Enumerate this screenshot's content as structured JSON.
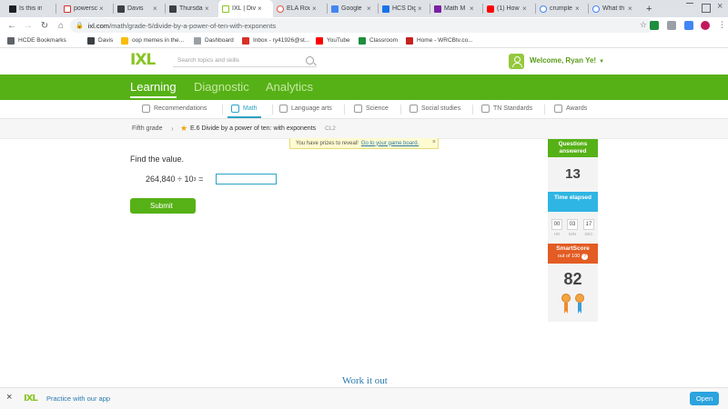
{
  "browser": {
    "tabs": [
      {
        "label": "Is this in",
        "icon": "square-icon",
        "color": "#202124"
      },
      {
        "label": "powersc",
        "icon": "gmail-icon",
        "color": "#d93025"
      },
      {
        "label": "Davis",
        "icon": "square-icon",
        "color": "#3c4043"
      },
      {
        "label": "Thursda",
        "icon": "square-icon",
        "color": "#3c4043"
      },
      {
        "label": "IXL | Div",
        "icon": "ixl-icon",
        "color": "#87c522"
      },
      {
        "label": "ELA Rou",
        "icon": "gear-icon",
        "color": "#e8523e"
      },
      {
        "label": "Google",
        "icon": "docs-icon",
        "color": "#4285f4"
      },
      {
        "label": "HCS Dig",
        "icon": "folder-icon",
        "color": "#1a73e8"
      },
      {
        "label": "Math M",
        "icon": "slides-icon",
        "color": "#7b1fa2"
      },
      {
        "label": "(1) How",
        "icon": "youtube-icon",
        "color": "#ff0000"
      },
      {
        "label": "crumple",
        "icon": "google-icon",
        "color": "#4285f4"
      },
      {
        "label": "What th",
        "icon": "google-icon",
        "color": "#4285f4"
      }
    ],
    "new_tab": "+",
    "url_host": "ixl.com",
    "url_path": "/math/grade-5/divide-by-a-power-of-ten-with-exponents",
    "bookmarks": [
      {
        "label": "HCDE Bookmarks",
        "color": "#5f6368"
      },
      {
        "label": "Davis",
        "color": "#3c4043"
      },
      {
        "label": "oop memes in the...",
        "color": "#fbbc04"
      },
      {
        "label": "Dashboard",
        "color": "#9aa0a6"
      },
      {
        "label": "Inbox - ry41926@st...",
        "color": "#d93025"
      },
      {
        "label": "YouTube",
        "color": "#ff0000"
      },
      {
        "label": "Classroom",
        "color": "#1e8e3e"
      },
      {
        "label": "Home - WRCBtv.co...",
        "color": "#c5221f"
      }
    ]
  },
  "ixl": {
    "logo": "IXL",
    "search_placeholder": "Search topics and skills",
    "welcome": "Welcome, Ryan Ye!",
    "main_nav": [
      "Learning",
      "Diagnostic",
      "Analytics"
    ],
    "subject_nav": [
      "Recommendations",
      "Math",
      "Language arts",
      "Science",
      "Social studies",
      "TN Standards",
      "Awards"
    ],
    "breadcrumb_grade": "Fifth grade",
    "breadcrumb_skill": "E.6 Divide by a power of ten: with exponents",
    "breadcrumb_code": "CL2",
    "prize_text": "You have prizes to reveal!",
    "prize_link": "Go to your game board.",
    "question_title": "Find the value.",
    "expr_left": "264,840 ÷ 10",
    "expr_exp": "3",
    "expr_eq": "=",
    "answer_value": "",
    "submit_label": "Submit",
    "sidebar": {
      "answered_label": "Questions answered",
      "answered_value": "13",
      "time_label": "Time elapsed",
      "time": {
        "hr": "00",
        "min": "03",
        "sec": "17"
      },
      "time_units": {
        "hr": "HR",
        "min": "MIN",
        "sec": "SEC"
      },
      "smartscore_label": "SmartScore",
      "smartscore_sub": "out of 100",
      "smartscore_help": "?",
      "smartscore_value": "82"
    },
    "work_it_out": "Work it out",
    "app_banner_text": "Practice with our app",
    "app_banner_button": "Open"
  }
}
